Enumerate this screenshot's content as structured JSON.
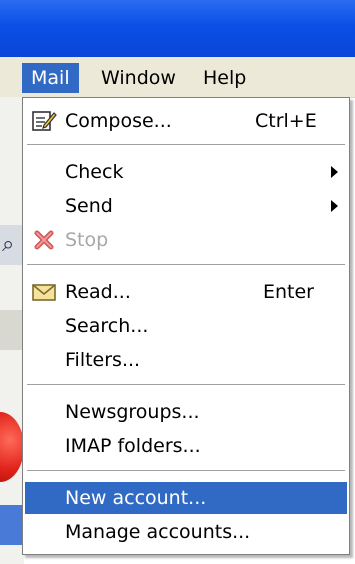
{
  "menubar": {
    "items": [
      {
        "label": "Mail",
        "active": true
      },
      {
        "label": "Window"
      },
      {
        "label": "Help"
      }
    ]
  },
  "menu": {
    "compose": {
      "label": "Compose...",
      "shortcut": "Ctrl+E",
      "icon": "compose-icon"
    },
    "check": {
      "label": "Check",
      "submenu": true
    },
    "send": {
      "label": "Send",
      "submenu": true
    },
    "stop": {
      "label": "Stop",
      "disabled": true,
      "icon": "stop-x-icon"
    },
    "read": {
      "label": "Read...",
      "shortcut": "Enter",
      "icon": "envelope-icon"
    },
    "search": {
      "label": "Search..."
    },
    "filters": {
      "label": "Filters..."
    },
    "newsgroups": {
      "label": "Newsgroups..."
    },
    "imap_folders": {
      "label": "IMAP folders..."
    },
    "new_account": {
      "label": "New account...",
      "highlighted": true
    },
    "manage_accounts": {
      "label": "Manage accounts..."
    }
  },
  "colors": {
    "titlebar": "#0b4fe6",
    "menubar": "#ece9d8",
    "highlight": "#316ac5",
    "disabled_text": "#a8a8a8",
    "stop_icon": "#d45a5a"
  }
}
